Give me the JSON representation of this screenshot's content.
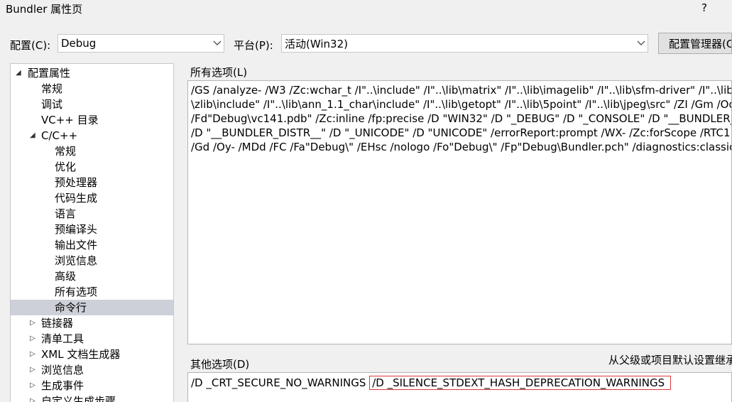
{
  "window": {
    "title": "Bundler 属性页",
    "help": "?"
  },
  "config": {
    "label": "配置(C):",
    "value": "Debug",
    "platform_label": "平台(P):",
    "platform_value": "活动(Win32)",
    "manager_button": "配置管理器(C"
  },
  "tree": {
    "root": "配置属性",
    "items": [
      {
        "label": "常规"
      },
      {
        "label": "调试"
      },
      {
        "label": "VC++ 目录"
      },
      {
        "label": "C/C++"
      },
      {
        "label": "常规"
      },
      {
        "label": "优化"
      },
      {
        "label": "预处理器"
      },
      {
        "label": "代码生成"
      },
      {
        "label": "语言"
      },
      {
        "label": "预编译头"
      },
      {
        "label": "输出文件"
      },
      {
        "label": "浏览信息"
      },
      {
        "label": "高级"
      },
      {
        "label": "所有选项"
      },
      {
        "label": "命令行"
      },
      {
        "label": "链接器"
      },
      {
        "label": "清单工具"
      },
      {
        "label": "XML 文档生成器"
      },
      {
        "label": "浏览信息"
      },
      {
        "label": "生成事件"
      },
      {
        "label": "自定义生成步骤"
      }
    ]
  },
  "all_options": {
    "label": "所有选项(L)",
    "lines": [
      "/GS /analyze- /W3 /Zc:wchar_t /I\"..\\include\" /I\"..\\lib\\matrix\" /I\"..\\lib\\imagelib\" /I\"..\\lib\\sfm-driver\" /I\"..\\lib",
      "\\zlib\\include\" /I\"..\\lib\\ann_1.1_char\\include\" /I\"..\\lib\\getopt\" /I\"..\\lib\\5point\" /I\"..\\lib\\jpeg\\src\" /ZI /Gm /Od",
      "/Fd\"Debug\\vc141.pdb\" /Zc:inline /fp:precise /D \"WIN32\" /D \"_DEBUG\" /D \"_CONSOLE\" /D \"__BUNDLER__\" /",
      "/D \"__BUNDLER_DISTR__\" /D \"_UNICODE\" /D \"UNICODE\" /errorReport:prompt /WX- /Zc:forScope /RTC1",
      "/Gd /Oy- /MDd /FC /Fa\"Debug\\\" /EHsc /nologo /Fo\"Debug\\\" /Fp\"Debug\\Bundler.pch\" /diagnostics:classic"
    ]
  },
  "other_options": {
    "label": "其他选项(D)",
    "inherit_label": "从父级或项目默认设置继承",
    "value_part1": "/D _CRT_SECURE_NO_WARNINGS",
    "value_part2": "/D _SILENCE_STDEXT_HASH_DEPRECATION_WARNINGS"
  }
}
